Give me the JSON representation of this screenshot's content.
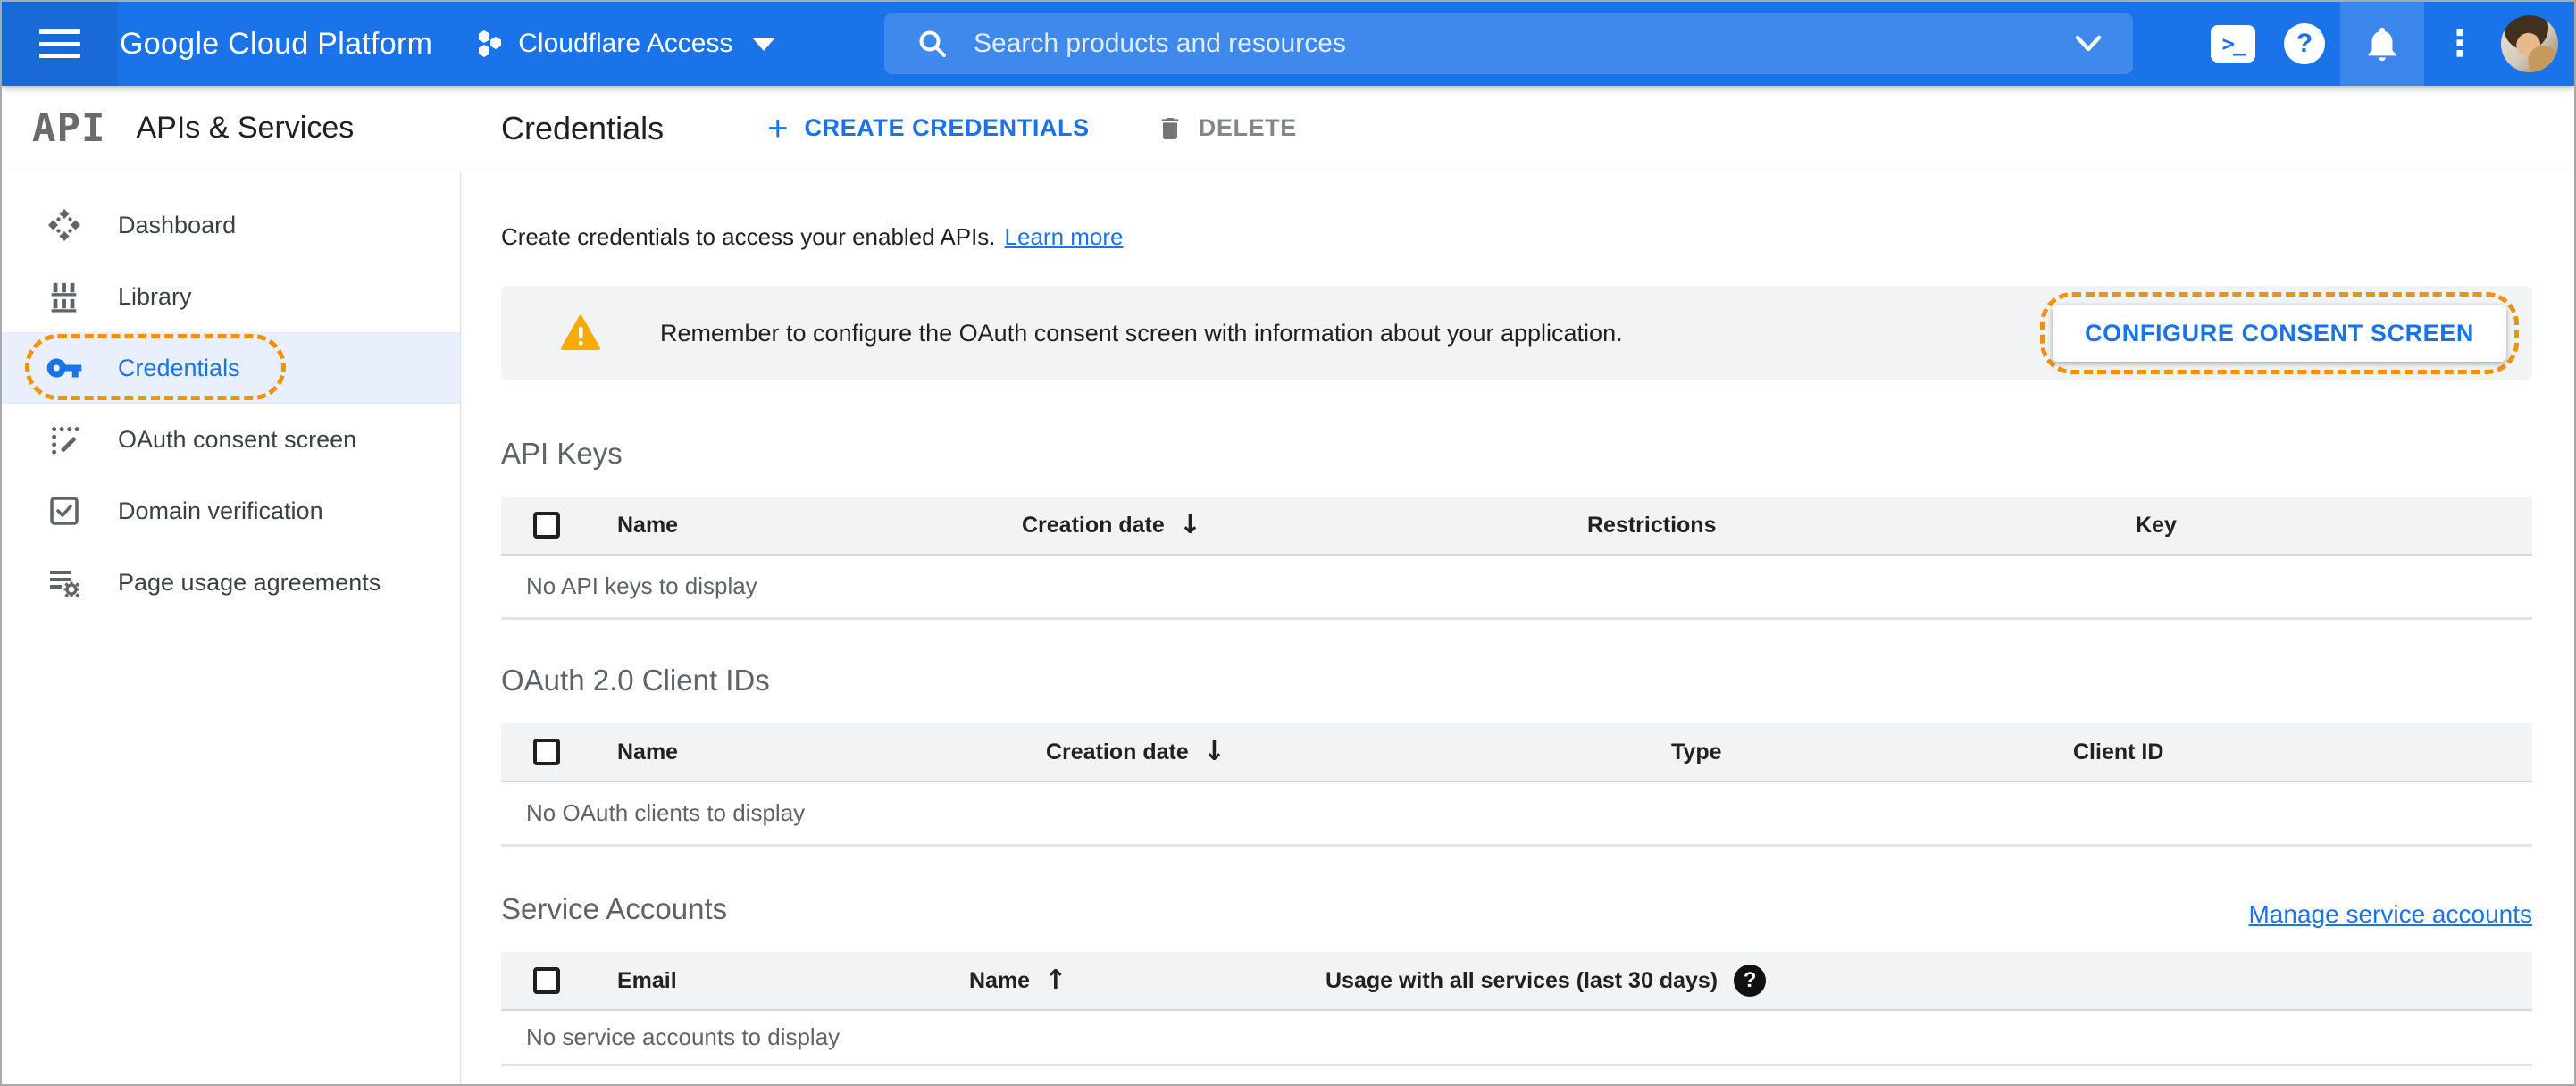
{
  "topbar": {
    "product_name": "Google Cloud Platform",
    "project_name": "Cloudflare Access",
    "search_placeholder": "Search products and resources",
    "terminal_glyph": ">_",
    "help_glyph": "?",
    "kebab_glyph": "⋮"
  },
  "sidebar": {
    "logo": "API",
    "title": "APIs & Services",
    "active_item": "Credentials",
    "items": [
      {
        "label": "Dashboard"
      },
      {
        "label": "Library"
      },
      {
        "label": "Credentials"
      },
      {
        "label": "OAuth consent screen"
      },
      {
        "label": "Domain verification"
      },
      {
        "label": "Page usage agreements"
      }
    ]
  },
  "header": {
    "title": "Credentials",
    "plus_glyph": "+",
    "create_label": "CREATE CREDENTIALS",
    "delete_label": "DELETE"
  },
  "main": {
    "intro": "Create credentials to access your enabled APIs.",
    "learn_more_label": "Learn more",
    "banner": {
      "message": "Remember to configure the OAuth consent screen with information about your application.",
      "button_label": "CONFIGURE CONSENT SCREEN"
    }
  },
  "tables": {
    "api_keys": {
      "title": "API Keys",
      "columns": [
        "Name",
        "Creation date",
        "Restrictions",
        "Key"
      ],
      "sort_column": "Creation date",
      "sort_direction": "desc",
      "sort_glyph": "↓",
      "empty": "No API keys to display"
    },
    "oauth_clients": {
      "title": "OAuth 2.0 Client IDs",
      "columns": [
        "Name",
        "Creation date",
        "Type",
        "Client ID"
      ],
      "sort_column": "Creation date",
      "sort_direction": "desc",
      "sort_glyph": "↓",
      "empty": "No OAuth clients to display"
    },
    "service_accounts": {
      "title": "Service Accounts",
      "manage_link": "Manage service accounts",
      "columns": [
        "Email",
        "Name",
        "Usage with all services (last 30 days)"
      ],
      "sort_column": "Name",
      "sort_direction": "asc",
      "sort_glyph": "↑",
      "help_glyph": "?",
      "empty": "No service accounts to display"
    }
  },
  "colors": {
    "topbar_blue": "#1a73e8",
    "accent_blue": "#1a73e8",
    "annotation_orange": "#ef920d",
    "warning_orange": "#f9ab00",
    "banner_bg": "#f1f3f4",
    "active_item_bg": "#e8f0fe"
  }
}
